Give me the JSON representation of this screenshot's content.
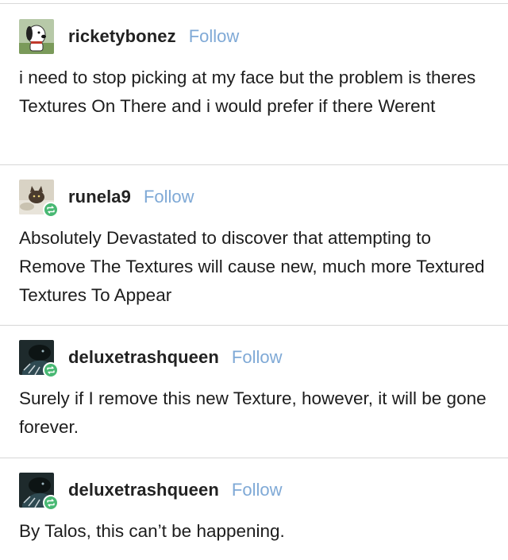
{
  "posts": [
    {
      "username": "ricketybonez",
      "follow_label": "Follow",
      "avatar": "snoopy-avatar",
      "reblog_badge": false,
      "text": "i need to stop picking at my face but the problem is theres Textures On There and i would prefer if there Werent"
    },
    {
      "username": "runela9",
      "follow_label": "Follow",
      "avatar": "cat-avatar",
      "reblog_badge": true,
      "text": "Absolutely Devastated to discover that attempting to Remove The Textures will cause new, much more Textured Textures To Appear"
    },
    {
      "username": "deluxetrashqueen",
      "follow_label": "Follow",
      "avatar": "dark-creature-avatar",
      "reblog_badge": true,
      "text": "Surely if I remove this new Texture, however, it will be gone forever."
    },
    {
      "username": "deluxetrashqueen",
      "follow_label": "Follow",
      "avatar": "dark-creature-avatar",
      "reblog_badge": true,
      "text": "By Talos, this can’t be happening."
    }
  ],
  "colors": {
    "follow": "#7fa9d6",
    "reblog_badge": "#48b873",
    "divider": "#d6d6d6"
  }
}
